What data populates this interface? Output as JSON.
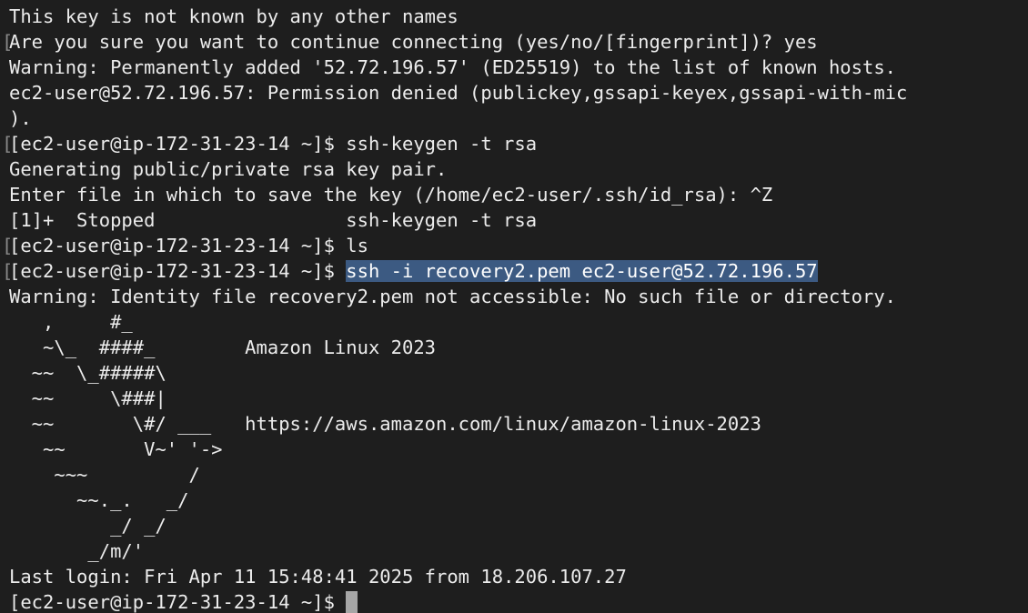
{
  "colors": {
    "background": "#1e1e1e",
    "text": "#ececec",
    "selection": "#3c5a82",
    "cursor": "#a6a6a6"
  },
  "prompt": "[ec2-user@ip-172-31-23-14 ~]$ ",
  "prompt_mark": "[",
  "lines": [
    "This key is not known by any other names",
    "Are you sure you want to continue connecting (yes/no/[fingerprint])? yes",
    "Warning: Permanently added '52.72.196.57' (ED25519) to the list of known hosts.",
    "ec2-user@52.72.196.57: Permission denied (publickey,gssapi-keyex,gssapi-with-mic",
    ")."
  ],
  "command_1": "ssh-keygen -t rsa",
  "keygen_output": [
    "Generating public/private rsa key pair.",
    "Enter file in which to save the key (/home/ec2-user/.ssh/id_rsa): ^Z",
    "[1]+  Stopped                 ssh-keygen -t rsa"
  ],
  "command_2": "ls",
  "command_3_selected": "ssh -i recovery2.pem ec2-user@52.72.196.57",
  "identity_warning": "Warning: Identity file recovery2.pem not accessible: No such file or directory.",
  "banner": [
    "   ,     #_",
    "   ~\\_  ####_        Amazon Linux 2023",
    "  ~~  \\_#####\\",
    "  ~~     \\###|",
    "  ~~       \\#/ ___   https://aws.amazon.com/linux/amazon-linux-2023",
    "   ~~       V~' '->",
    "    ~~~         /",
    "      ~~._.   _/",
    "         _/ _/",
    "       _/m/'"
  ],
  "last_login": "Last login: Fri Apr 11 15:48:41 2025 from 18.206.107.27",
  "final_prompt": "[ec2-user@ip-172-31-23-14 ~]$ "
}
